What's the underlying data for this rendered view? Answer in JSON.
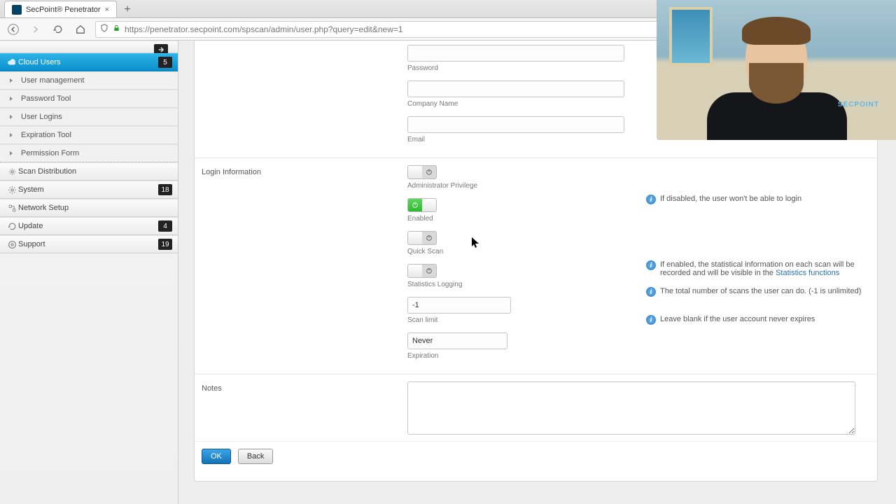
{
  "browser": {
    "tab_title": "SecPoint® Penetrator",
    "url": "https://penetrator.secpoint.com/spscan/admin/user.php?query=edit&new=1"
  },
  "sidebar": {
    "items": [
      {
        "label": "Cloud Users",
        "badge": "5",
        "kind": "header"
      },
      {
        "label": "User management",
        "kind": "sub"
      },
      {
        "label": "Password Tool",
        "kind": "sub"
      },
      {
        "label": "User Logins",
        "kind": "sub"
      },
      {
        "label": "Expiration Tool",
        "kind": "sub"
      },
      {
        "label": "Permission Form",
        "kind": "sub"
      },
      {
        "label": "Scan Distribution",
        "kind": "row"
      },
      {
        "label": "System",
        "badge": "18",
        "kind": "row"
      },
      {
        "label": "Network Setup",
        "kind": "row"
      },
      {
        "label": "Update",
        "badge": "4",
        "kind": "row"
      },
      {
        "label": "Support",
        "badge": "19",
        "kind": "row"
      }
    ]
  },
  "form": {
    "password": {
      "label": "Password",
      "value": ""
    },
    "company": {
      "label": "Company Name",
      "value": ""
    },
    "email": {
      "label": "Email",
      "value": ""
    },
    "section_login": "Login Information",
    "admin_priv": {
      "label": "Administrator Privilege",
      "on": false
    },
    "enabled": {
      "label": "Enabled",
      "on": true,
      "hint": "If disabled, the user won't be able to login"
    },
    "quick_scan": {
      "label": "Quick Scan",
      "on": false
    },
    "stats_log": {
      "label": "Statistics Logging",
      "on": false,
      "hint_pre": "If enabled, the statistical information on each scan will be recorded and will be visible in the ",
      "hint_link": "Statistics functions"
    },
    "scan_limit": {
      "label": "Scan limit",
      "value": "-1",
      "hint": "The total number of scans the user can do. (-1 is unlimited)"
    },
    "expiration": {
      "label": "Expiration",
      "value": "Never",
      "hint": "Leave blank if the user account never expires"
    },
    "section_notes": "Notes",
    "notes_value": "",
    "btn_ok": "OK",
    "btn_back": "Back"
  },
  "webcam": {
    "logo": "SECPOINT"
  }
}
